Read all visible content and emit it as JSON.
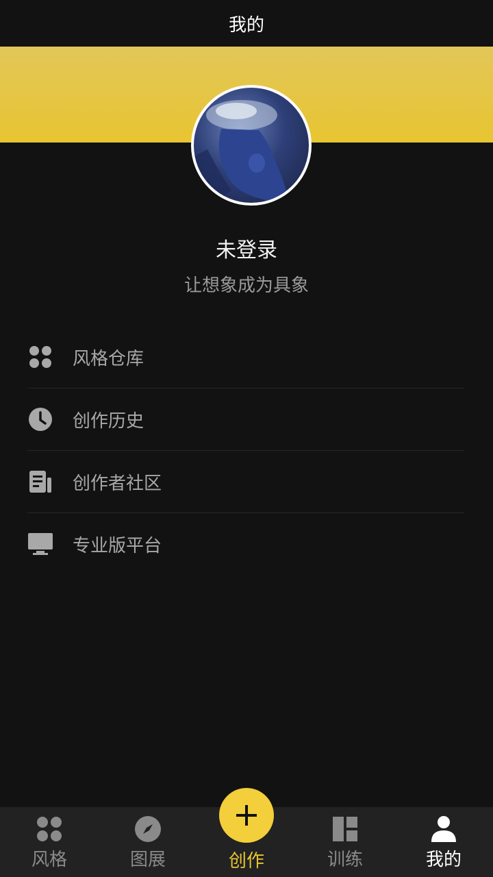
{
  "header": {
    "title": "我的"
  },
  "profile": {
    "name": "未登录",
    "tagline": "让想象成为具象"
  },
  "menu": {
    "items": [
      {
        "label": "风格仓库",
        "icon": "grid-icon"
      },
      {
        "label": "创作历史",
        "icon": "clock-icon"
      },
      {
        "label": "创作者社区",
        "icon": "document-icon"
      },
      {
        "label": "专业版平台",
        "icon": "monitor-icon"
      }
    ]
  },
  "tabbar": {
    "tabs": [
      {
        "label": "风格",
        "icon": "grid-icon"
      },
      {
        "label": "图展",
        "icon": "compass-icon"
      },
      {
        "label": "创作",
        "icon": "plus-icon"
      },
      {
        "label": "训练",
        "icon": "layout-icon"
      },
      {
        "label": "我的",
        "icon": "user-icon"
      }
    ],
    "active_index": 4
  },
  "colors": {
    "background": "#121212",
    "accent": "#e8c531",
    "tabbar_bg": "#222222",
    "muted_text": "#a8a8a8"
  }
}
